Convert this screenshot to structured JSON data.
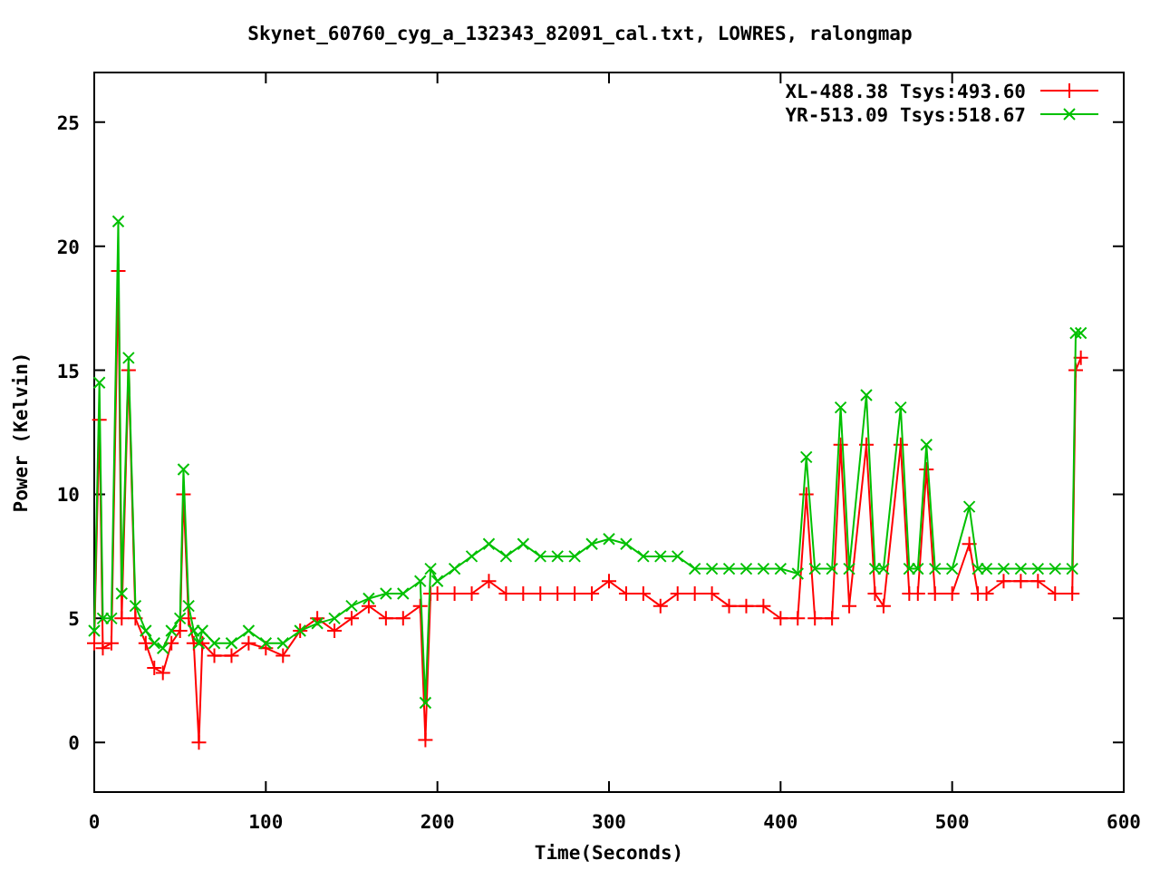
{
  "chart_data": {
    "type": "line",
    "title": "Skynet_60760_cyg_a_132343_82091_cal.txt, LOWRES, ralongmap",
    "xlabel": "Time(Seconds)",
    "ylabel": "Power (Kelvin)",
    "x": [
      0,
      3,
      5,
      10,
      14,
      16,
      20,
      24,
      30,
      35,
      40,
      45,
      50,
      52,
      55,
      58,
      61,
      63,
      70,
      80,
      90,
      100,
      110,
      120,
      130,
      140,
      150,
      160,
      170,
      180,
      190,
      193,
      196,
      200,
      210,
      220,
      230,
      240,
      250,
      260,
      270,
      280,
      290,
      300,
      310,
      320,
      330,
      340,
      350,
      360,
      370,
      380,
      390,
      400,
      410,
      415,
      420,
      430,
      435,
      440,
      450,
      455,
      460,
      470,
      475,
      480,
      485,
      490,
      500,
      510,
      515,
      520,
      530,
      540,
      550,
      560,
      570,
      572,
      575
    ],
    "series": [
      {
        "name": "XL-488.38 Tsys:493.60",
        "color": "#ff0000",
        "marker": "plus",
        "values": [
          4,
          13,
          3.8,
          4,
          19,
          5,
          15,
          5,
          4,
          3,
          2.8,
          4,
          4.5,
          10,
          5,
          4,
          0,
          4,
          3.5,
          3.5,
          4,
          3.8,
          3.5,
          4.5,
          5,
          4.5,
          5,
          5.5,
          5,
          5,
          5.5,
          0.1,
          6,
          6,
          6,
          6,
          6.5,
          6,
          6,
          6,
          6,
          6,
          6,
          6.5,
          6,
          6,
          5.5,
          6,
          6,
          6,
          5.5,
          5.5,
          5.5,
          5,
          5,
          10,
          5,
          5,
          12,
          5.5,
          12,
          6,
          5.5,
          12,
          6,
          6,
          11,
          6,
          6,
          8,
          6,
          6,
          6.5,
          6.5,
          6.5,
          6,
          6,
          15,
          15.5
        ]
      },
      {
        "name": "YR-513.09 Tsys:518.67",
        "color": "#00c000",
        "marker": "cross",
        "values": [
          4.5,
          14.5,
          5,
          5,
          21,
          6,
          15.5,
          5.5,
          4.5,
          4,
          3.8,
          4.5,
          5,
          11,
          5.5,
          4.5,
          4,
          4.5,
          4,
          4,
          4.5,
          4,
          4,
          4.5,
          4.8,
          5,
          5.5,
          5.8,
          6,
          6,
          6.5,
          1.6,
          7,
          6.5,
          7,
          7.5,
          8,
          7.5,
          8,
          7.5,
          7.5,
          7.5,
          8,
          8.2,
          8,
          7.5,
          7.5,
          7.5,
          7,
          7,
          7,
          7,
          7,
          7,
          6.8,
          11.5,
          7,
          7,
          13.5,
          7,
          14,
          7,
          7,
          13.5,
          7,
          7,
          12,
          7,
          7,
          9.5,
          7,
          7,
          7,
          7,
          7,
          7,
          7,
          16.5,
          16.5
        ]
      }
    ],
    "legend": true,
    "xlim": [
      0,
      600
    ],
    "ylim": [
      -2,
      27
    ],
    "xticks": [
      0,
      100,
      200,
      300,
      400,
      500,
      600
    ],
    "yticks": [
      0,
      5,
      10,
      15,
      20,
      25
    ]
  }
}
